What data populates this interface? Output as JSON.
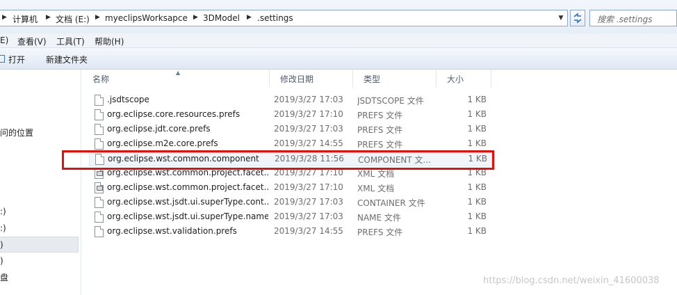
{
  "address_bar": {
    "crumbs": [
      "计算机",
      "文档 (E:)",
      "myeclipsWorksapce",
      "3DModel",
      ".settings"
    ],
    "search_placeholder": "搜索 .settings"
  },
  "menu": {
    "items": [
      "E)",
      "查看(V)",
      "工具(T)",
      "帮助(H)"
    ]
  },
  "toolbar": {
    "open_label": "打开",
    "new_folder_label": "新建文件夹"
  },
  "nav_pane": {
    "items": [
      "问的位置",
      ":)",
      ":)",
      ")",
      ")",
      "盘"
    ]
  },
  "columns": {
    "name": "名称",
    "date": "修改日期",
    "type": "类型",
    "size": "大小"
  },
  "files": [
    {
      "name": ".jsdtscope",
      "date": "2019/3/27 17:03",
      "type": "JSDTSCOPE 文件",
      "size": "1 KB",
      "icon": "file-icon"
    },
    {
      "name": "org.eclipse.core.resources.prefs",
      "date": "2019/3/27 17:10",
      "type": "PREFS 文件",
      "size": "1 KB",
      "icon": "file-icon"
    },
    {
      "name": "org.eclipse.jdt.core.prefs",
      "date": "2019/3/27 17:03",
      "type": "PREFS 文件",
      "size": "1 KB",
      "icon": "file-icon"
    },
    {
      "name": "org.eclipse.m2e.core.prefs",
      "date": "2019/3/27 14:55",
      "type": "PREFS 文件",
      "size": "1 KB",
      "icon": "file-icon"
    },
    {
      "name": "org.eclipse.wst.common.component",
      "date": "2019/3/28 11:56",
      "type": "COMPONENT 文...",
      "size": "1 KB",
      "icon": "file-icon"
    },
    {
      "name": "org.eclipse.wst.common.project.facet...",
      "date": "2019/3/27 17:10",
      "type": "XML 文档",
      "size": "1 KB",
      "icon": "xml-file-icon"
    },
    {
      "name": "org.eclipse.wst.common.project.facet...",
      "date": "2019/3/27 17:10",
      "type": "XML 文档",
      "size": "1 KB",
      "icon": "xml-file-icon"
    },
    {
      "name": "org.eclipse.wst.jsdt.ui.superType.cont...",
      "date": "2019/3/27 17:03",
      "type": "CONTAINER 文件",
      "size": "1 KB",
      "icon": "file-icon"
    },
    {
      "name": "org.eclipse.wst.jsdt.ui.superType.name",
      "date": "2019/3/27 17:03",
      "type": "NAME 文件",
      "size": "1 KB",
      "icon": "file-icon"
    },
    {
      "name": "org.eclipse.wst.validation.prefs",
      "date": "2019/3/27 14:55",
      "type": "PREFS 文件",
      "size": "1 KB",
      "icon": "file-icon"
    }
  ],
  "highlight_color": "#e2100b",
  "watermark": "https://blog.csdn.net/weixin_41600038"
}
